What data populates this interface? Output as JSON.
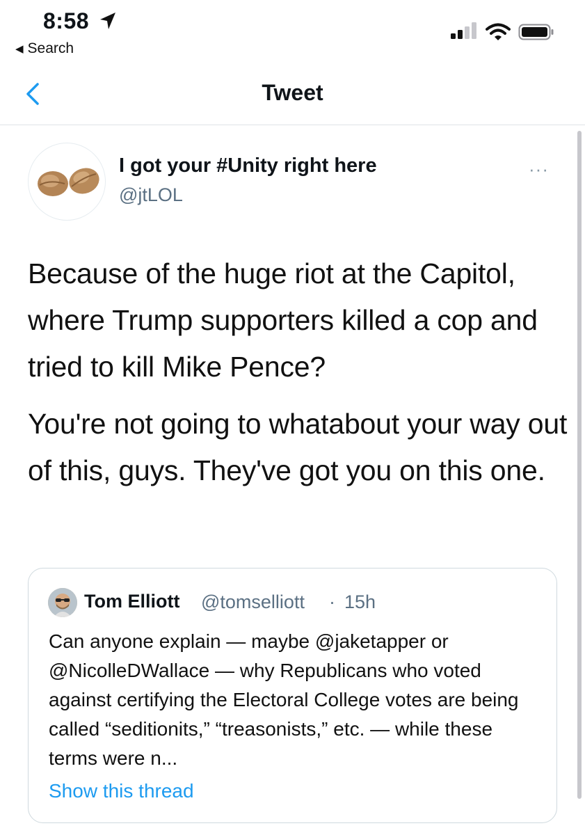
{
  "status_bar": {
    "time": "8:58",
    "back_app_label": "Search",
    "icons": [
      "location-arrow-icon",
      "cellular-signal-icon",
      "wifi-icon",
      "battery-icon"
    ]
  },
  "nav": {
    "title": "Tweet",
    "back_icon": "chevron-left-icon"
  },
  "tweet": {
    "display_name": "I got your #Unity right here",
    "handle": "@jtLOL",
    "avatar_icon": "two-walnuts-avatar",
    "more_label": "···",
    "paragraphs": [
      "Because of the huge riot at the Capitol, where Trump supporters killed a cop and tried to kill Mike Pence?",
      "You're not going to whatabout your way out of this, guys. They've got you on this one."
    ]
  },
  "quote": {
    "name": "Tom Elliott",
    "handle": "@tomselliott",
    "separator": "·",
    "time": "15h",
    "text": "Can anyone explain — maybe @jaketapper or @NicolleDWallace — why Republicans who voted against certifying the Electoral College votes are being called “seditionits,” “treasonists,” etc. — while these terms were n...",
    "show_thread": "Show this thread"
  },
  "colors": {
    "link": "#1d9bf0",
    "secondary_text": "#5b7083",
    "nav_back": "#1d9bf0",
    "divider": "#dfe3e6"
  }
}
